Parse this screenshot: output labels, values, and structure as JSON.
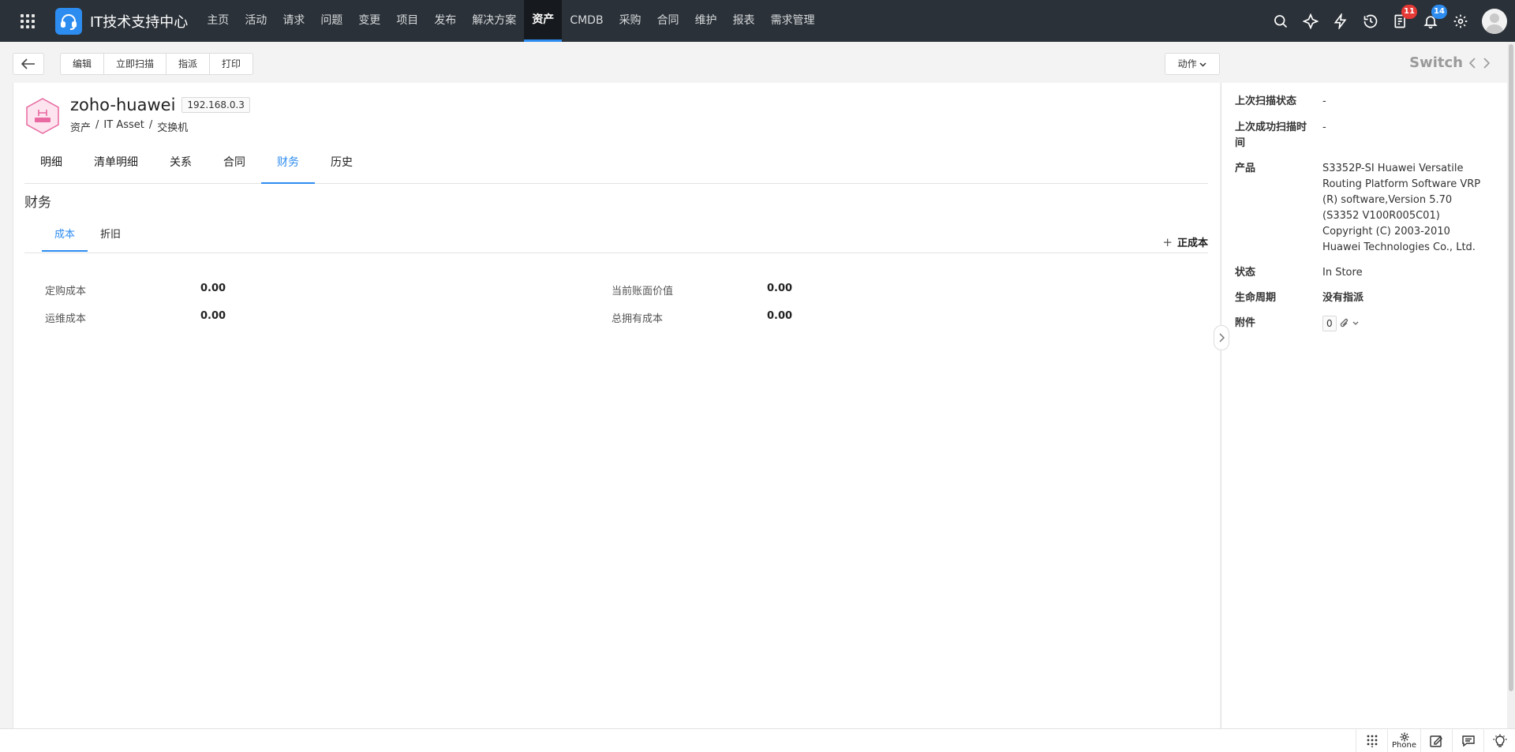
{
  "header": {
    "brand": "IT技术支持中心",
    "nav": [
      "主页",
      "活动",
      "请求",
      "问题",
      "变更",
      "项目",
      "发布",
      "解决方案",
      "资产",
      "CMDB",
      "采购",
      "合同",
      "维护",
      "报表",
      "需求管理"
    ],
    "active_nav": "资产",
    "todo_badge": "11",
    "notification_badge": "14"
  },
  "toolbar": {
    "edit": "编辑",
    "scan_now": "立即扫描",
    "assign": "指派",
    "print": "打印",
    "actions": "动作",
    "switch": "Switch"
  },
  "asset": {
    "name": "zoho-huawei",
    "ip": "192.168.0.3",
    "breadcrumb": [
      "资产",
      "/",
      "IT Asset",
      "/",
      "交换机"
    ]
  },
  "tabs": [
    "明细",
    "清单明细",
    "关系",
    "合同",
    "财务",
    "历史"
  ],
  "active_tab": "财务",
  "finance": {
    "title": "财务",
    "subtabs": [
      "成本",
      "折旧"
    ],
    "add_cost": "正成本",
    "fields": {
      "purchase_cost_label": "定购成本",
      "purchase_cost_value": "0.00",
      "ops_cost_label": "运维成本",
      "ops_cost_value": "0.00",
      "book_value_label": "当前账面价值",
      "book_value_value": "0.00",
      "tco_label": "总拥有成本",
      "tco_value": "0.00"
    }
  },
  "side": {
    "last_scan_status_label": "上次扫描状态",
    "last_scan_status_value": "-",
    "last_success_scan_label": "上次成功扫描时间",
    "last_success_scan_value": "-",
    "product_label": "产品",
    "product_value": "S3352P-SI Huawei Versatile Routing Platform Software VRP (R) software,Version 5.70 (S3352 V100R005C01) Copyright (C) 2003-2010 Huawei Technologies Co., Ltd.",
    "status_label": "状态",
    "status_value": "In Store",
    "lifecycle_label": "生命周期",
    "lifecycle_value": "没有指派",
    "attachment_label": "附件",
    "attachment_count": "0"
  },
  "bottom": {
    "phone": "Phone"
  },
  "colors": {
    "topbar": "#2a3138",
    "accent": "#2d8cf0",
    "badge_red": "#e53935"
  }
}
